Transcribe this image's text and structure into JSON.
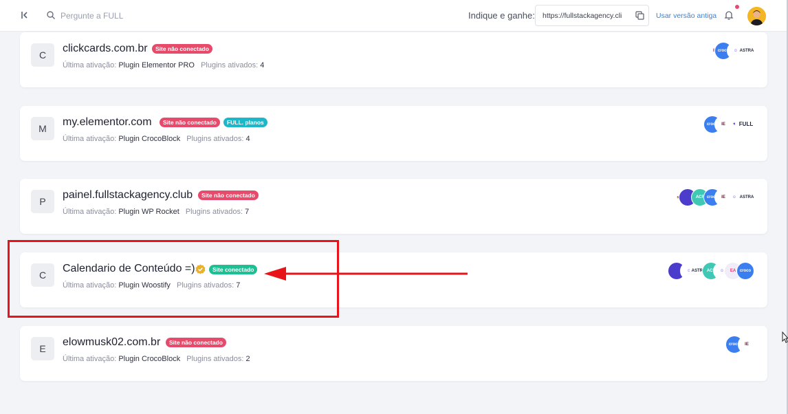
{
  "header": {
    "search_placeholder": "Pergunte a FULL",
    "referral_label": "Indique e ganhe:",
    "referral_url": "https://fullstackagency.cli",
    "old_version_link": "Usar versão antiga"
  },
  "labels": {
    "last_activation": "Última ativação:",
    "plugins_activated": "Plugins ativados:"
  },
  "sites": [
    {
      "initial": "C",
      "name": "clickcards.com.br",
      "badges": [
        "Site não conectado"
      ],
      "last_plugin": "Plugin Elementor PRO",
      "plugin_count": "4",
      "plugins": [
        "elementor-icon",
        "croco-icon",
        "happy-addons-icon",
        "astra-icon"
      ]
    },
    {
      "initial": "M",
      "name": "my.elementor.com",
      "badges": [
        "Site não conectado",
        "FULL. planos"
      ],
      "last_plugin": "Plugin CrocoBlock",
      "plugin_count": "4",
      "plugins": [
        "croco-icon",
        "elementor-icon",
        "astra-icon",
        "full-logo-icon"
      ]
    },
    {
      "initial": "P",
      "name": "painel.fullstackagency.club",
      "badges": [
        "Site não conectado"
      ],
      "last_plugin": "Plugin WP Rocket",
      "plugin_count": "7",
      "plugins": [
        "wp-rocket-icon",
        "woostify-icon",
        "acf-icon",
        "croco-icon",
        "elementor-icon",
        "happy-addons-icon",
        "astra-icon"
      ]
    },
    {
      "initial": "C",
      "name": "Calendario de Conteúdo =)",
      "verified": true,
      "badges": [
        "Site conectado"
      ],
      "last_plugin": "Plugin Woostify",
      "plugin_count": "7",
      "plugins": [
        "woostify-icon",
        "happy-addons-icon",
        "astra-icon",
        "acf-icon",
        "happy-addons-icon",
        "essential-addons-icon",
        "croco-icon"
      ]
    },
    {
      "initial": "E",
      "name": "elowmusk02.com.br",
      "badges": [
        "Site não conectado"
      ],
      "last_plugin": "Plugin CrocoBlock",
      "plugin_count": "2",
      "plugins": [
        "croco-icon",
        "elementor-icon"
      ]
    }
  ],
  "plugin_icon_text": {
    "astra": "ASTRA",
    "full": "FULL",
    "croco": "croco",
    "acf": "ACF"
  },
  "colors": {
    "badge_disconnected": "#e74b6c",
    "badge_plans": "#1cb8c9",
    "badge_connected": "#1fbf94",
    "link": "#3b82d6",
    "annotation": "#e8141a"
  }
}
